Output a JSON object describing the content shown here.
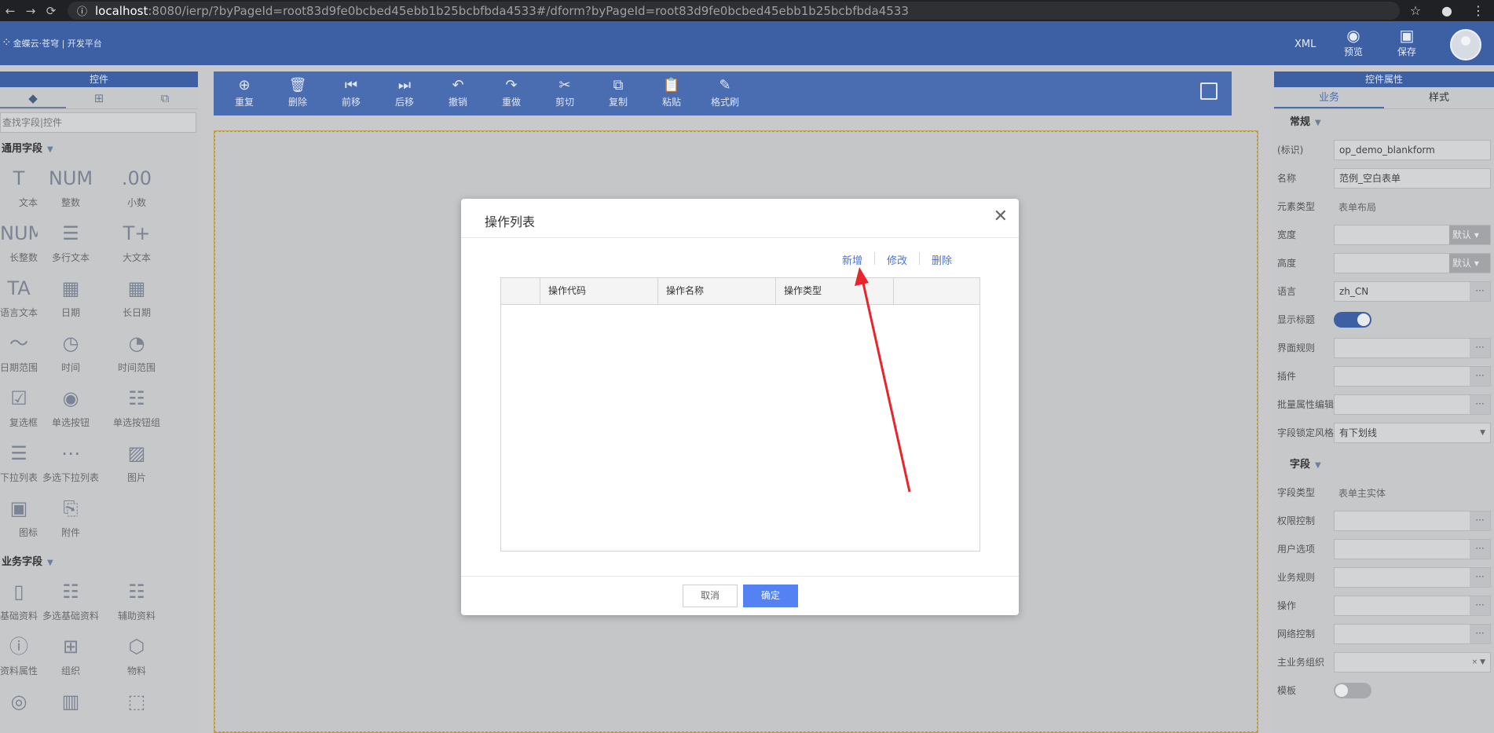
{
  "browser": {
    "url_host": "localhost",
    "url_rest": ":8080/ierp/?byPageId=root83d9fe0bcbed45ebb1b25bcbfbda4533#/dform?byPageId=root83d9fe0bcbed45ebb1b25bcbfbda4533"
  },
  "header": {
    "logo_text": "金蝶云·苍穹 | 开发平台",
    "xml_label": "XML",
    "preview_label": "预览",
    "save_label": "保存"
  },
  "left_panel": {
    "title": "控件",
    "search_placeholder": "查找字段|控件",
    "section_general": "通用字段",
    "general_items": [
      "文本",
      "整数",
      "小数",
      "长整数",
      "多行文本",
      "大文本",
      "多语言文本",
      "日期",
      "长日期",
      "日期范围",
      "时间",
      "时间范围",
      "复选框",
      "单选按钮",
      "单选按钮组",
      "下拉列表",
      "多选下拉列表",
      "图片",
      "图标",
      "附件"
    ],
    "section_business": "业务字段",
    "business_items": [
      "基础资料",
      "多选基础资料",
      "辅助资料",
      "基础资料属性",
      "组织",
      "物料",
      "",
      "",
      ""
    ]
  },
  "toolbar": {
    "items": [
      "重复",
      "删除",
      "前移",
      "后移",
      "撤销",
      "重做",
      "剪切",
      "复制",
      "粘贴",
      "格式刷"
    ]
  },
  "right_panel": {
    "title": "控件属性",
    "tab_business": "业务",
    "tab_style": "样式",
    "section_common": "常规",
    "identifier_label": "(标识)",
    "identifier_value": "op_demo_blankform",
    "name_label": "名称",
    "name_value": "范例_空白表单",
    "element_type_label": "元素类型",
    "element_type_value": "表单布局",
    "width_label": "宽度",
    "height_label": "高度",
    "unit_default": "默认",
    "language_label": "语言",
    "language_value": "zh_CN",
    "show_title_label": "显示标题",
    "ui_rules_label": "界面规则",
    "plugins_label": "插件",
    "batch_edit_label": "批量属性编辑",
    "field_lock_label": "字段锁定风格",
    "field_lock_value": "有下划线",
    "section_field": "字段",
    "field_type_label": "字段类型",
    "field_type_value": "表单主实体",
    "permission_label": "权限控制",
    "user_options_label": "用户选项",
    "business_rules_label": "业务规则",
    "operation_label": "操作",
    "network_label": "网络控制",
    "main_org_label": "主业务组织",
    "template_label": "模板"
  },
  "modal": {
    "title": "操作列表",
    "add_label": "新增",
    "edit_label": "修改",
    "delete_label": "删除",
    "columns": [
      "操作代码",
      "操作名称",
      "操作类型"
    ],
    "cancel_label": "取消",
    "ok_label": "确定"
  }
}
